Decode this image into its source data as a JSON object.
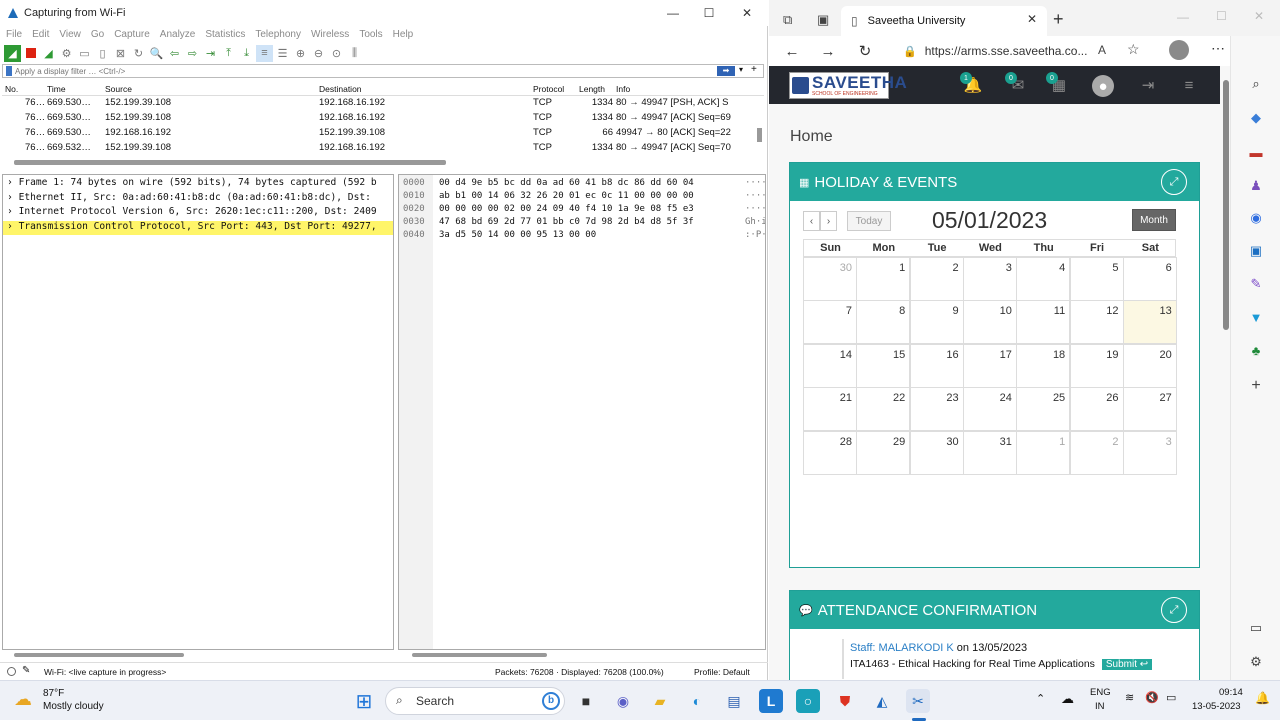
{
  "wireshark": {
    "title": "Capturing from Wi-Fi",
    "menu": [
      "File",
      "Edit",
      "View",
      "Go",
      "Capture",
      "Analyze",
      "Statistics",
      "Telephony",
      "Wireless",
      "Tools",
      "Help"
    ],
    "filter_placeholder": "Apply a display filter … <Ctrl-/>",
    "columns": [
      "No.",
      "Time",
      "Source",
      "Destination",
      "Protocol",
      "Length",
      "Info"
    ],
    "packets": [
      {
        "no": "76…",
        "time": "669.530…",
        "src": "152.199.39.108",
        "dst": "192.168.16.192",
        "proto": "TCP",
        "len": "1334",
        "info": "80 → 49947 [PSH, ACK] S"
      },
      {
        "no": "76…",
        "time": "669.530…",
        "src": "152.199.39.108",
        "dst": "192.168.16.192",
        "proto": "TCP",
        "len": "1334",
        "info": "80 → 49947 [ACK] Seq=69"
      },
      {
        "no": "76…",
        "time": "669.530…",
        "src": "192.168.16.192",
        "dst": "152.199.39.108",
        "proto": "TCP",
        "len": "66",
        "info": "49947 → 80 [ACK] Seq=22"
      },
      {
        "no": "76…",
        "time": "669.532…",
        "src": "152.199.39.108",
        "dst": "192.168.16.192",
        "proto": "TCP",
        "len": "1334",
        "info": "80 → 49947 [ACK] Seq=70"
      }
    ],
    "tree": [
      "Frame 1: 74 bytes on wire (592 bits), 74 bytes captured (592 b",
      "Ethernet II, Src: 0a:ad:60:41:b8:dc (0a:ad:60:41:b8:dc), Dst: ",
      "Internet Protocol Version 6, Src: 2620:1ec:c11::200, Dst: 2409",
      "Transmission Control Protocol, Src Port: 443, Dst Port: 49277,"
    ],
    "hex": [
      {
        "off": "0000",
        "hex": "00 d4 9e b5 bc dd 0a ad  60 41 b8 dc 86 dd 60 04",
        "asc": "····"
      },
      {
        "off": "0010",
        "hex": "ab b1 00 14 06 32 26 20  01 ec 0c 11 00 00 00 00",
        "asc": "····"
      },
      {
        "off": "0020",
        "hex": "00 00 00 00 02 00 24 09  40 f4 10 1a 9e 08 f5 e3",
        "asc": "····"
      },
      {
        "off": "0030",
        "hex": "47 68 bd 69 2d 77 01 bb  c0 7d 98 2d b4 d8 5f 3f",
        "asc": "Gh·i"
      },
      {
        "off": "0040",
        "hex": "3a d5 50 14 00 00 95 13  00 00",
        "asc": ":·P·"
      }
    ],
    "status_left": "Wi-Fi: <live capture in progress>",
    "status_mid": "Packets: 76208 · Displayed: 76208 (100.0%)",
    "status_right": "Profile: Default"
  },
  "browser": {
    "tab_title": "Saveetha University",
    "url": "https://arms.sse.saveetha.co...",
    "site": {
      "logo_title": "SAVEETHA",
      "logo_sub": "SCHOOL OF ENGINEERING",
      "badges": [
        "1",
        "0",
        "0"
      ],
      "breadcrumb": "Home",
      "holiday_title": "HOLIDAY & EVENTS",
      "today_label": "Today",
      "date": "05/01/2023",
      "month_label": "Month",
      "weekdays": [
        "Sun",
        "Mon",
        "Tue",
        "Wed",
        "Thu",
        "Fri",
        "Sat"
      ],
      "days": [
        {
          "d": "30",
          "other": true
        },
        {
          "d": "1"
        },
        {
          "d": "2"
        },
        {
          "d": "3"
        },
        {
          "d": "4"
        },
        {
          "d": "5"
        },
        {
          "d": "6"
        },
        {
          "d": "7"
        },
        {
          "d": "8"
        },
        {
          "d": "9"
        },
        {
          "d": "10"
        },
        {
          "d": "11"
        },
        {
          "d": "12"
        },
        {
          "d": "13",
          "today": true
        },
        {
          "d": "14"
        },
        {
          "d": "15"
        },
        {
          "d": "16"
        },
        {
          "d": "17"
        },
        {
          "d": "18"
        },
        {
          "d": "19"
        },
        {
          "d": "20"
        },
        {
          "d": "21"
        },
        {
          "d": "22"
        },
        {
          "d": "23"
        },
        {
          "d": "24"
        },
        {
          "d": "25"
        },
        {
          "d": "26"
        },
        {
          "d": "27"
        },
        {
          "d": "28"
        },
        {
          "d": "29"
        },
        {
          "d": "30"
        },
        {
          "d": "31"
        },
        {
          "d": "1",
          "other": true
        },
        {
          "d": "2",
          "other": true
        },
        {
          "d": "3",
          "other": true
        }
      ],
      "attendance_title": "ATTENDANCE CONFIRMATION",
      "staff_link": "Staff: MALARKODI K",
      "staff_date": "on 13/05/2023",
      "course": "ITA1463 - Ethical Hacking for Real Time Applications",
      "submit_label": "Submit"
    }
  },
  "taskbar": {
    "weather_temp": "87°F",
    "weather_desc": "Mostly cloudy",
    "search_label": "Search",
    "lang1": "ENG",
    "lang2": "IN",
    "time": "09:14",
    "date": "13-05-2023"
  },
  "colors": {
    "teal": "#23a99d",
    "site_header": "#24272e",
    "highlight": "#fff569"
  }
}
